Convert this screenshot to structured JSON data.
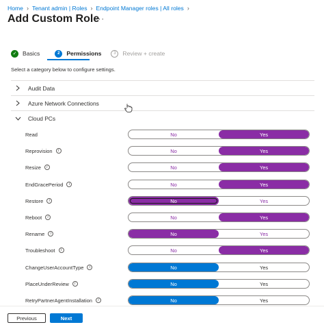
{
  "breadcrumb": [
    {
      "label": "Home"
    },
    {
      "label": "Tenant admin | Roles"
    },
    {
      "label": "Endpoint Manager roles | All roles"
    }
  ],
  "page": {
    "title": "Add Custom Role",
    "more_icon": "ellipsis-icon"
  },
  "wizard": {
    "steps": [
      {
        "label": "Basics",
        "state": "done"
      },
      {
        "label": "Permissions",
        "state": "active",
        "number": "2"
      },
      {
        "label": "Review + create",
        "state": "future",
        "number": "3"
      }
    ]
  },
  "instructions": "Select a category below to configure settings.",
  "categories": [
    {
      "label": "Audit Data",
      "expanded": false
    },
    {
      "label": "Azure Network Connections",
      "expanded": false
    },
    {
      "label": "Cloud PCs",
      "expanded": true
    }
  ],
  "toggle_options": {
    "no": "No",
    "yes": "Yes"
  },
  "permissions": [
    {
      "label": "Read",
      "selected": "Yes",
      "info": false
    },
    {
      "label": "Reprovision",
      "selected": "Yes",
      "info": true
    },
    {
      "label": "Resize",
      "selected": "Yes",
      "info": true
    },
    {
      "label": "EndGracePeriod",
      "selected": "Yes",
      "info": true
    },
    {
      "label": "Restore",
      "selected": "No",
      "info": true
    },
    {
      "label": "Reboot",
      "selected": "Yes",
      "info": true
    },
    {
      "label": "Rename",
      "selected": "No",
      "info": true
    },
    {
      "label": "Troubleshoot",
      "selected": "Yes",
      "info": true
    },
    {
      "label": "ChangeUserAccountType",
      "selected": "No",
      "info": true
    },
    {
      "label": "PlaceUnderReview",
      "selected": "No",
      "info": true
    },
    {
      "label": "RetryPartnerAgentInstallation",
      "selected": "No",
      "info": true
    }
  ],
  "footer": {
    "previous_label": "Previous",
    "next_label": "Next"
  },
  "colors": {
    "accent": "#0078d4",
    "selected_purple": "#8a2da5",
    "done_green": "#107c10"
  }
}
